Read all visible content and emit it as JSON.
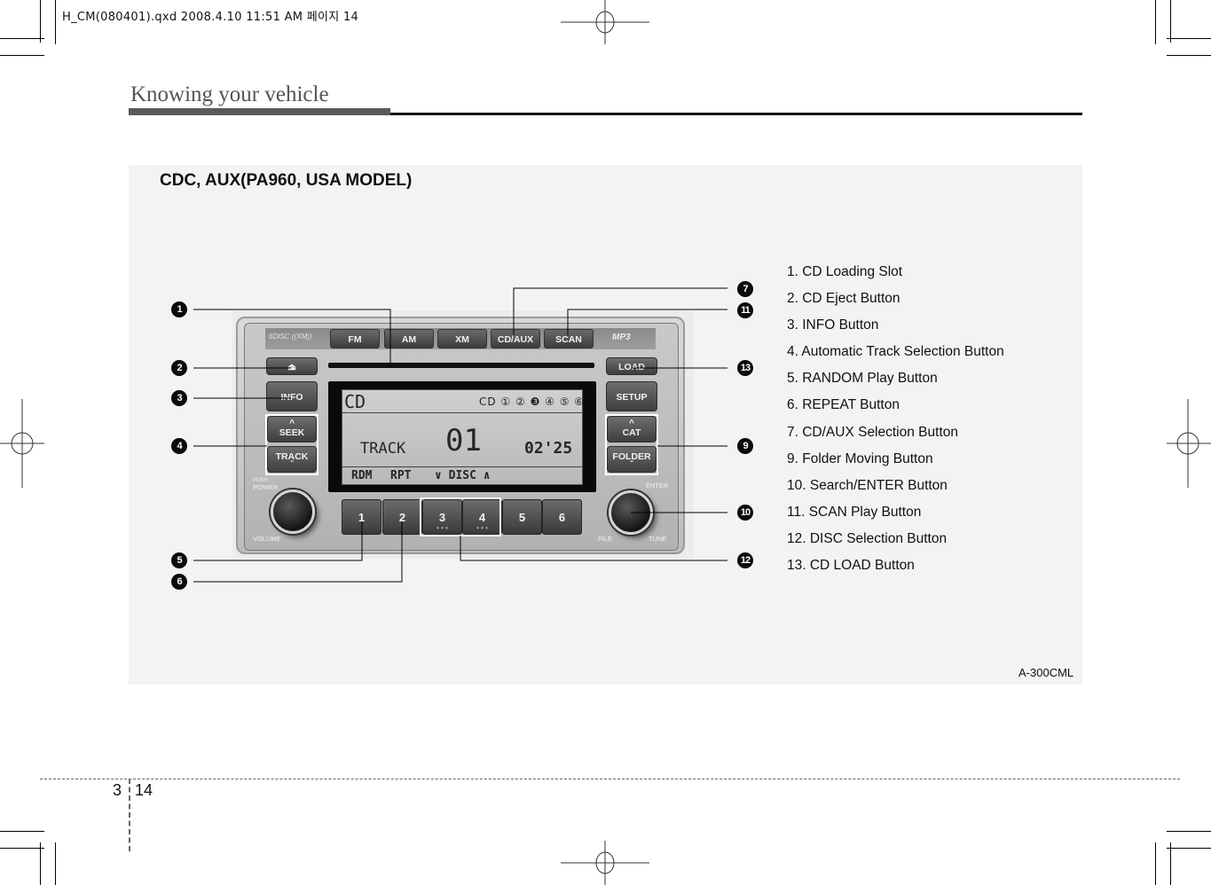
{
  "print_slug": "H_CM(080401).qxd  2008.4.10  11:51 AM  페이지 14",
  "header": {
    "section_title": "Knowing your vehicle"
  },
  "figure": {
    "heading": "CDC, AUX(PA960, USA MODEL)",
    "code": "A-300CML",
    "radio": {
      "brand_logo": "6DISC  ((XM))",
      "mp3_logo": "MP3",
      "top_buttons": [
        "FM",
        "AM",
        "XM",
        "CD/AUX",
        "SCAN"
      ],
      "left_buttons": {
        "eject": "⏏",
        "info": "INFO",
        "seek": "SEEK",
        "track": "TRACK"
      },
      "right_buttons": {
        "load": "LOAD",
        "setup": "SETUP",
        "cat": "CAT",
        "folder": "FOLDER"
      },
      "knob_labels": {
        "push": "PUSH",
        "power": "POWER",
        "volume": "VOLUME",
        "enter": "ENTER",
        "file": "FILE",
        "tune": "TUNE"
      },
      "presets": [
        "1",
        "2",
        "3",
        "4",
        "5",
        "6"
      ],
      "preset_dots": "• • •",
      "display": {
        "mode": "CD",
        "disc_indicator": "CD ① ② ❸ ④ ⑤ ⑥",
        "selected_disc": 3,
        "track_label": "TRACK",
        "track_number": "01",
        "elapsed_time": "02'25",
        "bottom_rdm": "RDM",
        "bottom_rpt": "RPT",
        "bottom_disc": "∨ DISC ∧"
      }
    },
    "callouts_left": [
      "1",
      "2",
      "3",
      "4",
      "5",
      "6"
    ],
    "callouts_right": [
      "7",
      "11",
      "13",
      "9",
      "10",
      "12"
    ],
    "legend": [
      "1. CD Loading Slot",
      "2. CD Eject Button",
      "3. INFO Button",
      "4. Automatic Track Selection Button",
      "5. RANDOM Play Button",
      "6. REPEAT Button",
      "7. CD/AUX Selection Button",
      "9. Folder Moving Button",
      "10. Search/ENTER Button",
      "11. SCAN Play Button",
      "12. DISC Selection Button",
      "13. CD LOAD Button"
    ]
  },
  "footer": {
    "chapter": "3",
    "page": "14"
  }
}
